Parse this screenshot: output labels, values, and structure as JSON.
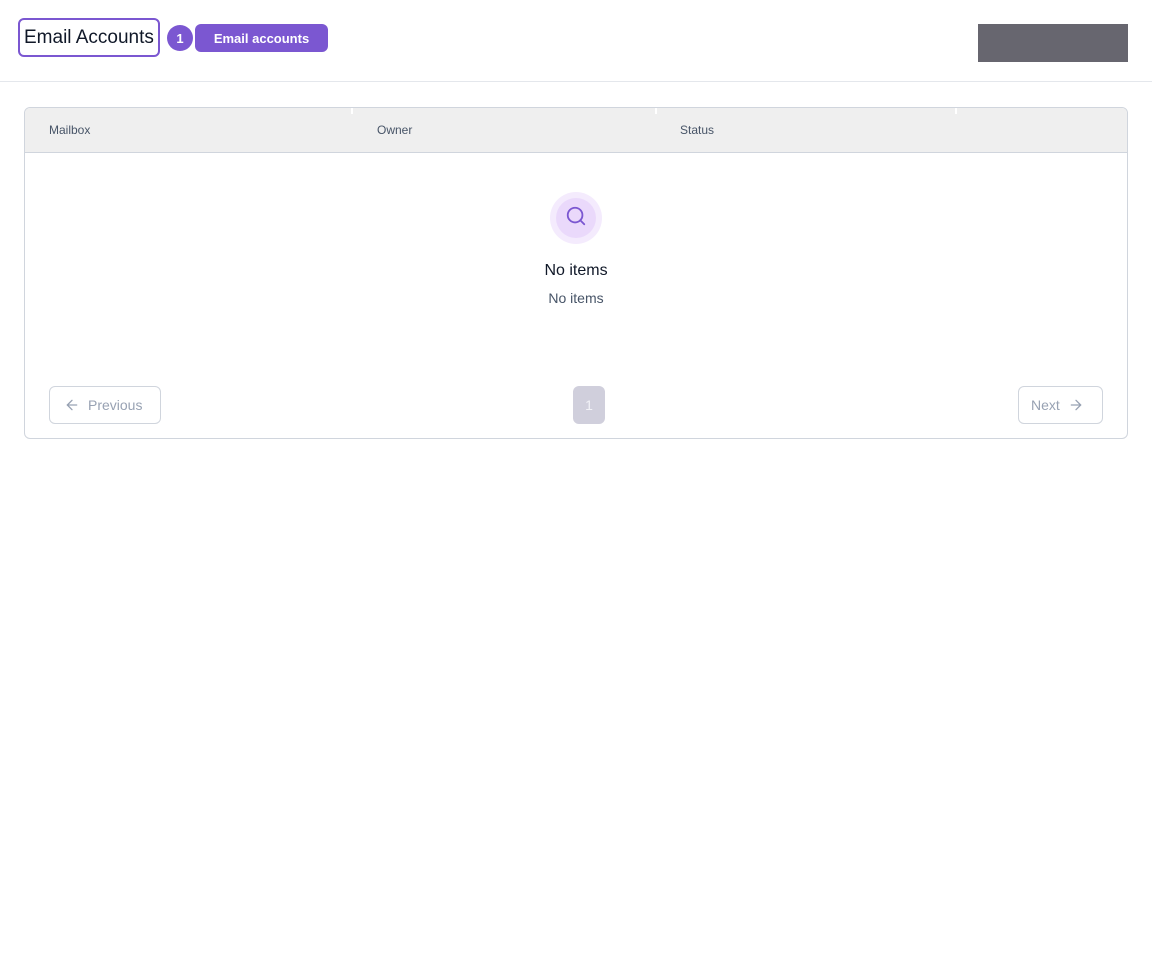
{
  "header": {
    "title": "Email Accounts",
    "count": "1",
    "tag": "Email accounts"
  },
  "table": {
    "columns": [
      "Mailbox",
      "Owner",
      "Status"
    ],
    "rows": []
  },
  "empty_state": {
    "icon": "search-icon",
    "title": "No items",
    "subtitle": "No items"
  },
  "pagination": {
    "previous_label": "Previous",
    "next_label": "Next",
    "current_page": "1",
    "previous_icon": "arrow-left-icon",
    "next_icon": "arrow-right-icon"
  },
  "colors": {
    "accent": "#7b57d1",
    "header_action": "#67666f",
    "table_header_bg": "#efefef"
  }
}
